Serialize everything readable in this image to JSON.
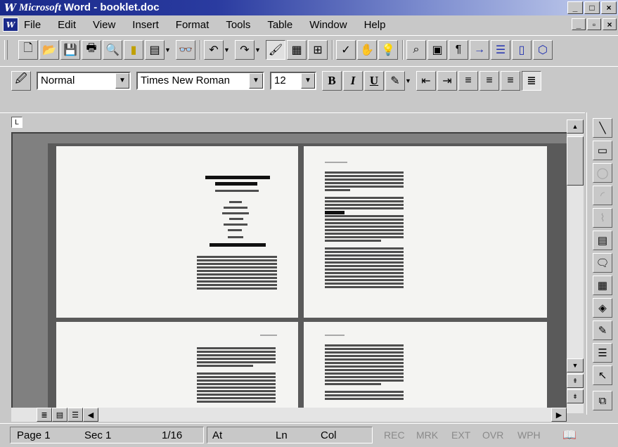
{
  "window": {
    "logo": "W",
    "app_brand": "Microsoft",
    "title": "Word - booklet.doc",
    "min": "_",
    "max": "□",
    "close": "×"
  },
  "menu": {
    "items": [
      {
        "label": "File"
      },
      {
        "label": "Edit"
      },
      {
        "label": "View"
      },
      {
        "label": "Insert"
      },
      {
        "label": "Format"
      },
      {
        "label": "Tools"
      },
      {
        "label": "Table"
      },
      {
        "label": "Window"
      },
      {
        "label": "Help"
      }
    ]
  },
  "formatting": {
    "style": "Normal",
    "font": "Times New Roman",
    "size": "12",
    "bold": "B",
    "italic": "I",
    "underline": "U"
  },
  "statusbar": {
    "page": "Page 1",
    "section": "Sec 1",
    "count": "1/16",
    "at": "At",
    "ln": "Ln",
    "col": "Col",
    "rec": "REC",
    "mrk": "MRK",
    "ext": "EXT",
    "ovr": "OVR",
    "wph": "WPH"
  },
  "colors": {
    "title_start": "#1a2a8a",
    "title_end": "#c6d0ee",
    "chrome": "#c8c8c8",
    "page": "#f4f4f2",
    "desk": "#5a5a5a"
  },
  "icons": {
    "standard_toolbar": [
      "new-icon",
      "open-icon",
      "save-icon",
      "print-icon",
      "print-preview-icon",
      "spelling-icon",
      "cut-icon",
      "copy-icon",
      "find-icon",
      "undo-icon",
      "redo-icon",
      "format-painter-icon",
      "table-icon",
      "columns-icon",
      "spell-check-icon",
      "hand-icon",
      "tip-icon",
      "zoom-icon",
      "page-icon",
      "pilcrow-icon",
      "arrow-icon",
      "equal-icon",
      "book-icon",
      "shapes-icon"
    ]
  }
}
